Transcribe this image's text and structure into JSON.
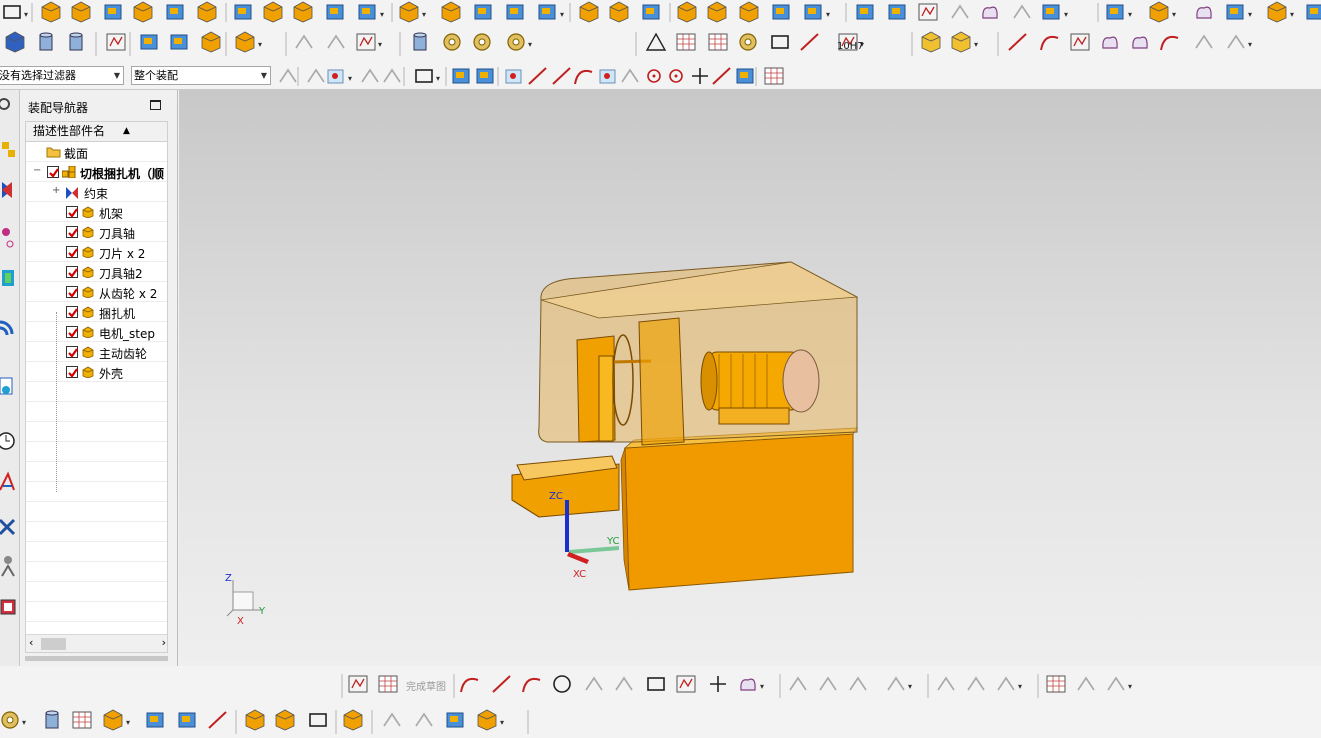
{
  "filters": {
    "selection_filter": "没有选择过滤器",
    "scope": "整个装配"
  },
  "navigator": {
    "title": "装配导航器",
    "column_header": "描述性部件名",
    "items": [
      {
        "label": "截面",
        "kind": "folder"
      },
      {
        "label": "切根捆扎机（顺",
        "kind": "assembly",
        "checked": true
      },
      {
        "label": "约束",
        "kind": "constraints"
      },
      {
        "label": "机架",
        "kind": "part",
        "checked": true
      },
      {
        "label": "刀具轴",
        "kind": "part",
        "checked": true
      },
      {
        "label": "刀片 x 2",
        "kind": "part",
        "checked": true
      },
      {
        "label": "刀具轴2",
        "kind": "part",
        "checked": true
      },
      {
        "label": "从齿轮 x 2",
        "kind": "part",
        "checked": true
      },
      {
        "label": "捆扎机",
        "kind": "part",
        "checked": true
      },
      {
        "label": "电机_step",
        "kind": "part",
        "checked": true
      },
      {
        "label": "主动齿轮",
        "kind": "part",
        "checked": true
      },
      {
        "label": "外壳",
        "kind": "part",
        "checked": true
      }
    ]
  },
  "toolbar": {
    "dimension_label": "10H7",
    "finish_sketch_label": "完成草图"
  },
  "viewport": {
    "wcs_labels": {
      "x": "XC",
      "y": "YC",
      "z": "ZC"
    },
    "triad_labels": {
      "x": "X",
      "y": "Y",
      "z": "Z"
    }
  },
  "colors": {
    "model_orange": "#f0a000",
    "model_transparent": "#e8b860",
    "check_red": "#d40000",
    "axis_blue": "#1a2fd0",
    "axis_green": "#20a040",
    "axis_red": "#d02020"
  }
}
